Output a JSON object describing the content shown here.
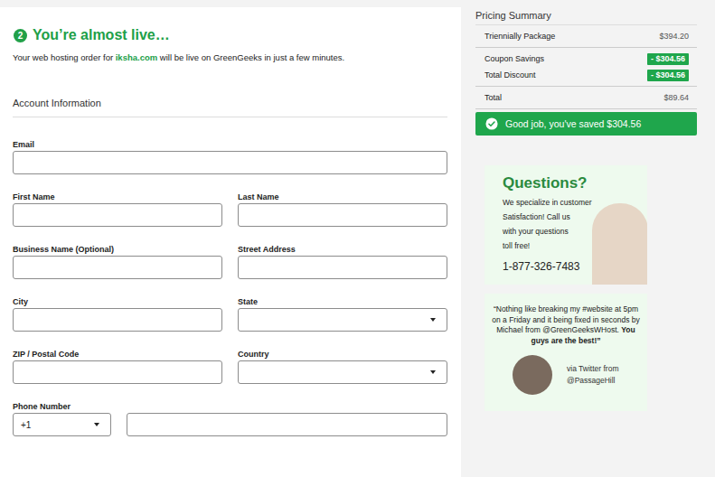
{
  "step": {
    "number": "2",
    "title": "You’re almost live…"
  },
  "intro": {
    "before": "Your web hosting order for ",
    "domain": "iksha.com",
    "after": " will be live on GreenGeeks in just a few minutes."
  },
  "section_title": "Account Information",
  "form_rows": [
    [
      {
        "label": "Email",
        "kind": "text"
      }
    ],
    [
      {
        "label": "First Name",
        "kind": "text"
      },
      {
        "label": "Last Name",
        "kind": "text"
      }
    ],
    [
      {
        "label": "Business Name (Optional)",
        "kind": "text"
      },
      {
        "label": "Street Address",
        "kind": "text"
      }
    ],
    [
      {
        "label": "City",
        "kind": "text"
      },
      {
        "label": "State",
        "kind": "select"
      }
    ],
    [
      {
        "label": "ZIP / Postal Code",
        "kind": "text"
      },
      {
        "label": "Country",
        "kind": "select"
      }
    ],
    [
      {
        "label": "Phone Number",
        "kind": "phone",
        "code": "+1"
      }
    ]
  ],
  "pricing": {
    "title": "Pricing Summary",
    "groups": [
      [
        {
          "label": "Triennially Package",
          "amount": "$394.20",
          "kind": "plain"
        }
      ],
      [
        {
          "label": "Coupon Savings",
          "amount": "- $304.56",
          "kind": "discount"
        },
        {
          "label": "Total Discount",
          "amount": "- $304.56",
          "kind": "discount"
        }
      ],
      [
        {
          "label": "Total",
          "amount": "$89.64",
          "kind": "plain"
        }
      ]
    ],
    "savings_banner": "Good job, you've saved $304.56"
  },
  "ad": {
    "title": "Questions?",
    "lines": [
      "We specialize in customer",
      "Satisfaction! Call us",
      "with your questions",
      "toll free!"
    ],
    "phone": "1-877-326-7483"
  },
  "testimonial": {
    "quote": "“Nothing like breaking my #website at 5pm on a Friday and it being fixed in seconds by Michael from @GreenGeeksWHost.",
    "quote_bold": "You guys are the best!”",
    "source_lines": [
      "via Twitter from",
      "@PassageHill"
    ]
  }
}
